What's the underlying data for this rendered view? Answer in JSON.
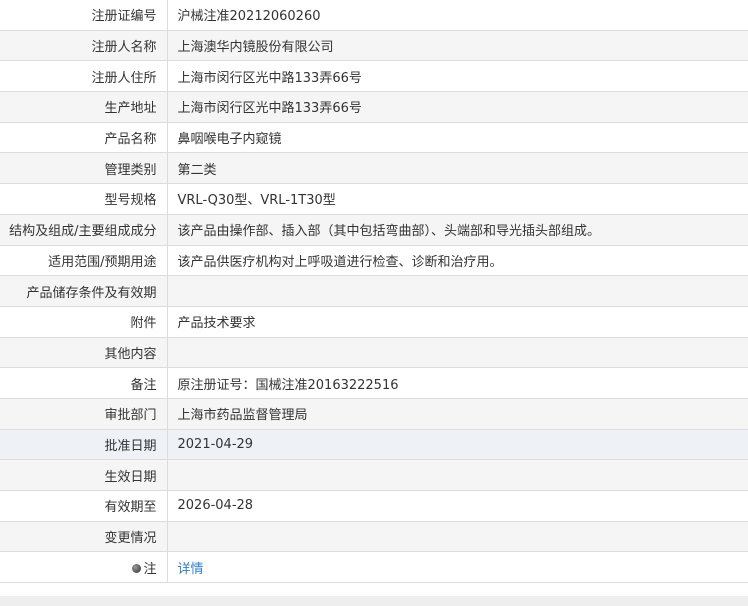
{
  "rows": [
    {
      "label": "注册证编号",
      "value": "沪械注准20212060260"
    },
    {
      "label": "注册人名称",
      "value": "上海澳华内镜股份有限公司"
    },
    {
      "label": "注册人住所",
      "value": "上海市闵行区光中路133弄66号"
    },
    {
      "label": "生产地址",
      "value": "上海市闵行区光中路133弄66号"
    },
    {
      "label": "产品名称",
      "value": "鼻咽喉电子内窥镜"
    },
    {
      "label": "管理类别",
      "value": "第二类"
    },
    {
      "label": "型号规格",
      "value": "VRL-Q30型、VRL-1T30型"
    },
    {
      "label": "结构及组成/主要组成成分",
      "value": "该产品由操作部、插入部（其中包括弯曲部）、头端部和导光插头部组成。"
    },
    {
      "label": "适用范围/预期用途",
      "value": "该产品供医疗机构对上呼吸道进行检查、诊断和治疗用。"
    },
    {
      "label": "产品储存条件及有效期",
      "value": ""
    },
    {
      "label": "附件",
      "value": "产品技术要求"
    },
    {
      "label": "其他内容",
      "value": ""
    },
    {
      "label": "备注",
      "value": "原注册证号：国械注准20163222516"
    },
    {
      "label": "审批部门",
      "value": "上海市药品监督管理局"
    },
    {
      "label": "批准日期",
      "value": "2021-04-29"
    },
    {
      "label": "生效日期",
      "value": ""
    },
    {
      "label": "有效期至",
      "value": "2026-04-28"
    },
    {
      "label": "变更情况",
      "value": ""
    }
  ],
  "note_row": {
    "label": "注",
    "icon": "bulb-icon",
    "link_text": "详情"
  },
  "colors": {
    "border": "#dcdcdc",
    "zebra": "#f5f5f5",
    "highlight": "#eef2f7",
    "link": "#2e7fc6"
  }
}
